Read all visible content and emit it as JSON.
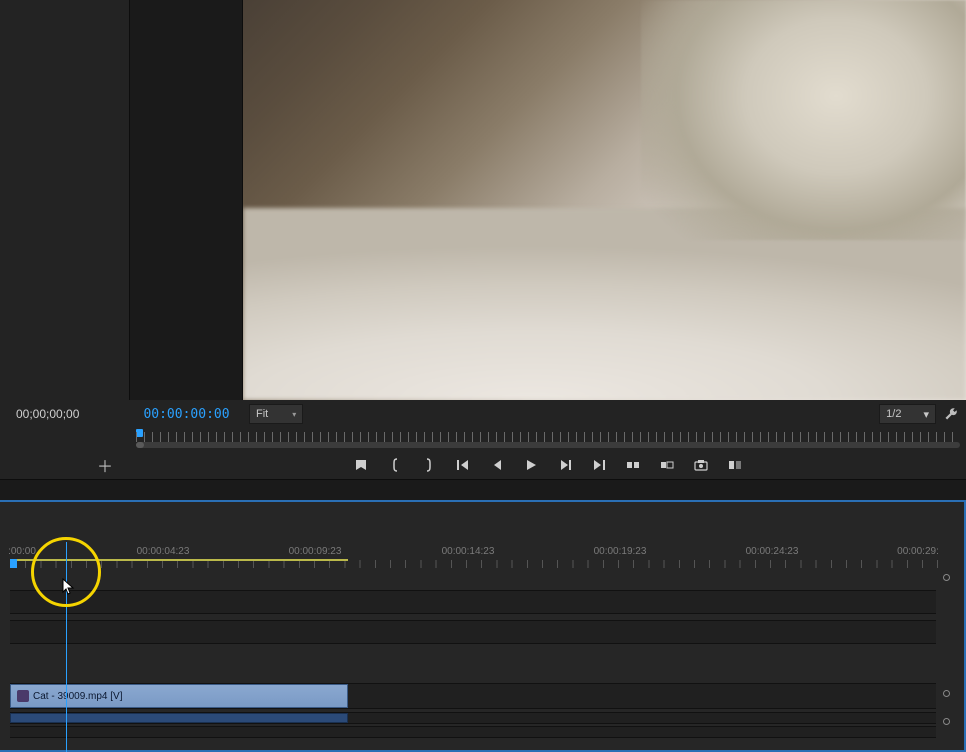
{
  "source_timecode": "00;00;00;00",
  "program_timecode": "00:00:00:00",
  "zoom_fit": "Fit",
  "resolution": "1/2",
  "timeline": {
    "ruler_labels": [
      {
        "pos": 22,
        "text": ":00:00"
      },
      {
        "pos": 163,
        "text": "00:00:04:23"
      },
      {
        "pos": 315,
        "text": "00:00:09:23"
      },
      {
        "pos": 468,
        "text": "00:00:14:23"
      },
      {
        "pos": 620,
        "text": "00:00:19:23"
      },
      {
        "pos": 772,
        "text": "00:00:24:23"
      },
      {
        "pos": 918,
        "text": "00:00:29:"
      }
    ],
    "clip_name": "Cat - 39009.mp4 [V]"
  },
  "transport_icons": {
    "mark_in": "mark-in",
    "in_brace": "{",
    "out_brace": "}",
    "go_in": "go-to-in",
    "step_back": "step-back",
    "play": "play",
    "step_fwd": "step-forward",
    "go_out": "go-to-out",
    "insert": "insert",
    "overwrite": "overwrite",
    "export_frame": "export-frame",
    "lift": "lift"
  }
}
